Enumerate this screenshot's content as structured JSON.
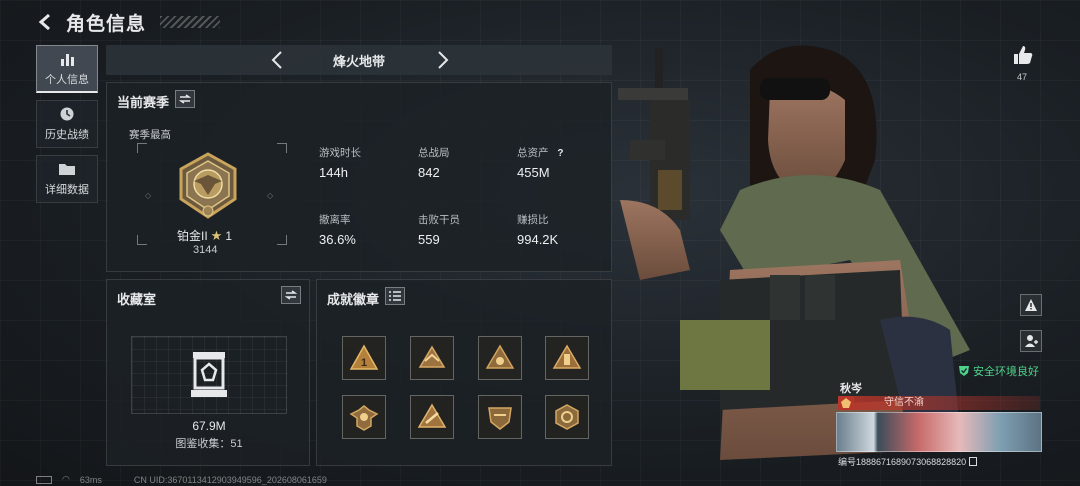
{
  "header": {
    "title": "角色信息"
  },
  "sidebar": {
    "items": [
      {
        "label": "个人信息",
        "icon": "bar-chart-icon",
        "active": true
      },
      {
        "label": "历史战绩",
        "icon": "clock-icon",
        "active": false
      },
      {
        "label": "详细数据",
        "icon": "folder-icon",
        "active": false
      }
    ]
  },
  "mode": {
    "label": "烽火地带"
  },
  "season": {
    "title": "当前赛季",
    "best_label": "赛季最高",
    "rank_name": "铂金II",
    "rank_stars": "1",
    "rank_points": "3144",
    "stats": [
      {
        "key": "游戏时长",
        "value": "144h"
      },
      {
        "key": "总战局",
        "value": "842"
      },
      {
        "key": "总资产",
        "value": "455M"
      },
      {
        "key": "撤离率",
        "value": "36.6%"
      },
      {
        "key": "击败干员",
        "value": "559"
      },
      {
        "key": "赚损比",
        "value": "994.2K"
      }
    ],
    "help_glyph": "?"
  },
  "collection": {
    "title": "收藏室",
    "value": "67.9M",
    "count_label": "图鉴收集：51"
  },
  "achievements": {
    "title": "成就徽章",
    "badges": [
      "badge-1",
      "badge-2",
      "badge-3",
      "badge-4",
      "badge-5",
      "badge-6",
      "badge-7",
      "badge-8"
    ]
  },
  "profile": {
    "likes": "47",
    "player_name": "秋岑",
    "tag": "守信不渝",
    "env_status": "安全环境良好",
    "player_id": "编号1888671689073068828820"
  },
  "footer": {
    "ping": "63ms",
    "uid": "CN UID:3670113412903949596_202608061659"
  },
  "colors": {
    "accent_green": "#4fd38a",
    "tag_red": "#b8352a",
    "gold": "#c9a45a"
  }
}
